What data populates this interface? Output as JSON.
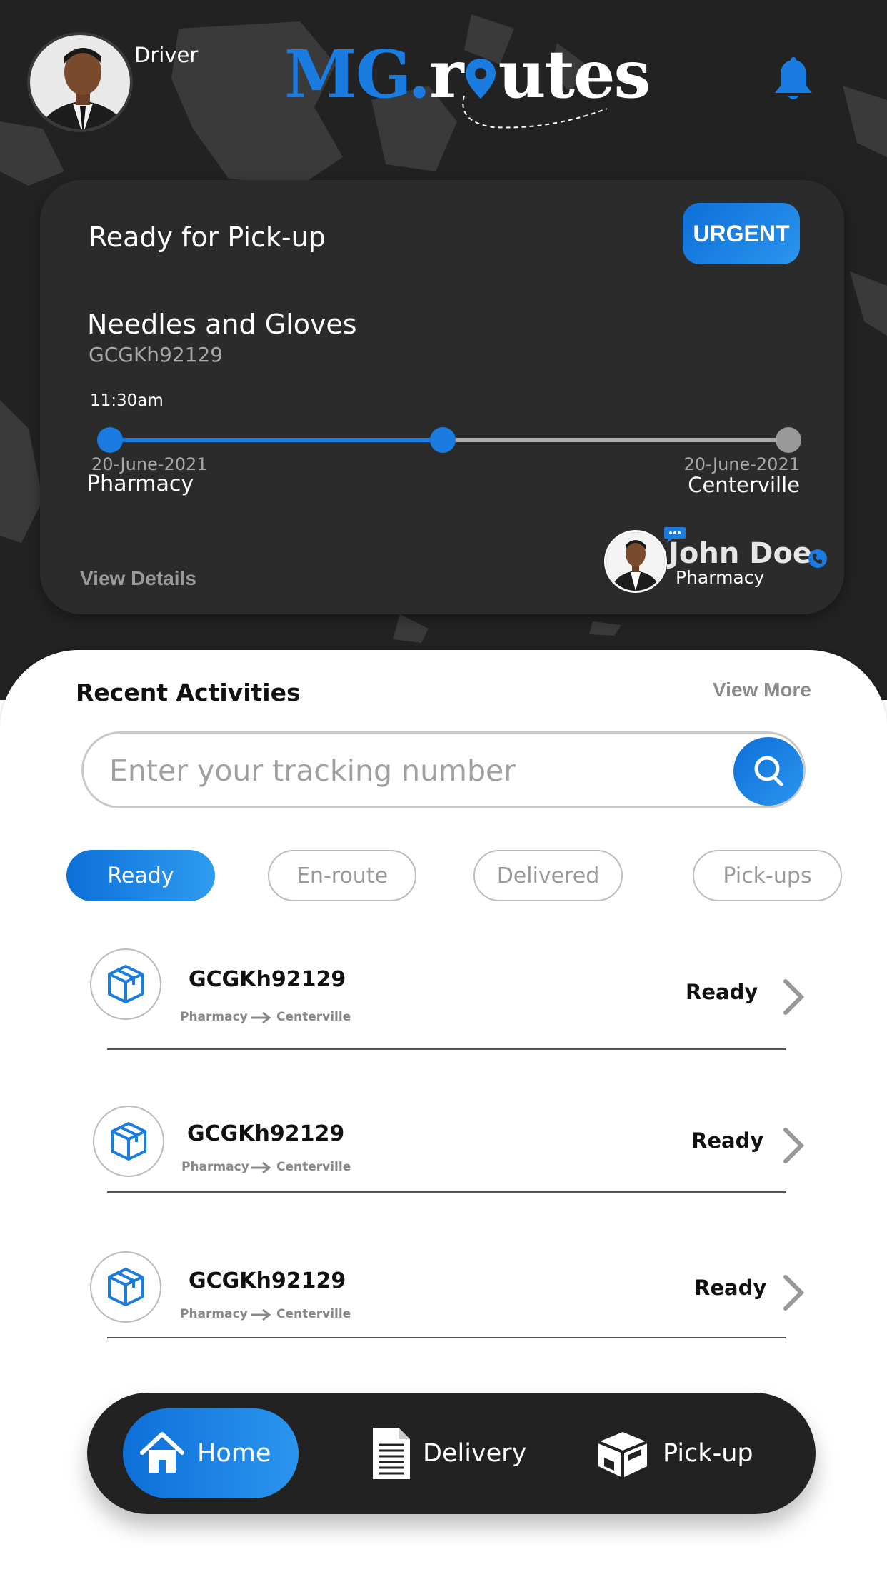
{
  "header": {
    "role": "Driver",
    "logo_mg": "MG.",
    "logo_r": "r",
    "logo_rest": "utes"
  },
  "current_card": {
    "status": "Ready for Pick-up",
    "priority": "URGENT",
    "item_name": "Needles and Gloves",
    "tracking_code": "GCGKh92129",
    "time": "11:30am",
    "progress": 0.5,
    "from": {
      "date": "20-June-2021",
      "place": "Pharmacy"
    },
    "to": {
      "date": "20-June-2021",
      "place": "Centerville"
    },
    "view_details": "View Details",
    "contact": {
      "name": "John Doe",
      "org": "Pharmacy"
    }
  },
  "recent": {
    "title": "Recent Activities",
    "view_more": "View More",
    "search_placeholder": "Enter your tracking number",
    "filters": [
      {
        "label": "Ready",
        "active": true
      },
      {
        "label": "En-route",
        "active": false
      },
      {
        "label": "Delivered",
        "active": false
      },
      {
        "label": "Pick-ups",
        "active": false
      }
    ],
    "items": [
      {
        "code": "GCGKh92129",
        "from": "Pharmacy",
        "to": "Centerville",
        "status": "Ready"
      },
      {
        "code": "GCGKh92129",
        "from": "Pharmacy",
        "to": "Centerville",
        "status": "Ready"
      },
      {
        "code": "GCGKh92129",
        "from": "Pharmacy",
        "to": "Centerville",
        "status": "Ready"
      }
    ]
  },
  "nav": {
    "home": "Home",
    "delivery": "Delivery",
    "pickup": "Pick-up"
  },
  "colors": {
    "accent": "#1a7be0",
    "dark_bg": "#222222",
    "card_bg": "#2b2b2b"
  },
  "icons": {
    "bell": "bell-icon",
    "search": "search-icon",
    "package": "package-icon",
    "chevron": "chevron-right-icon",
    "home": "home-icon",
    "delivery": "document-icon",
    "pickup": "box-icon"
  }
}
